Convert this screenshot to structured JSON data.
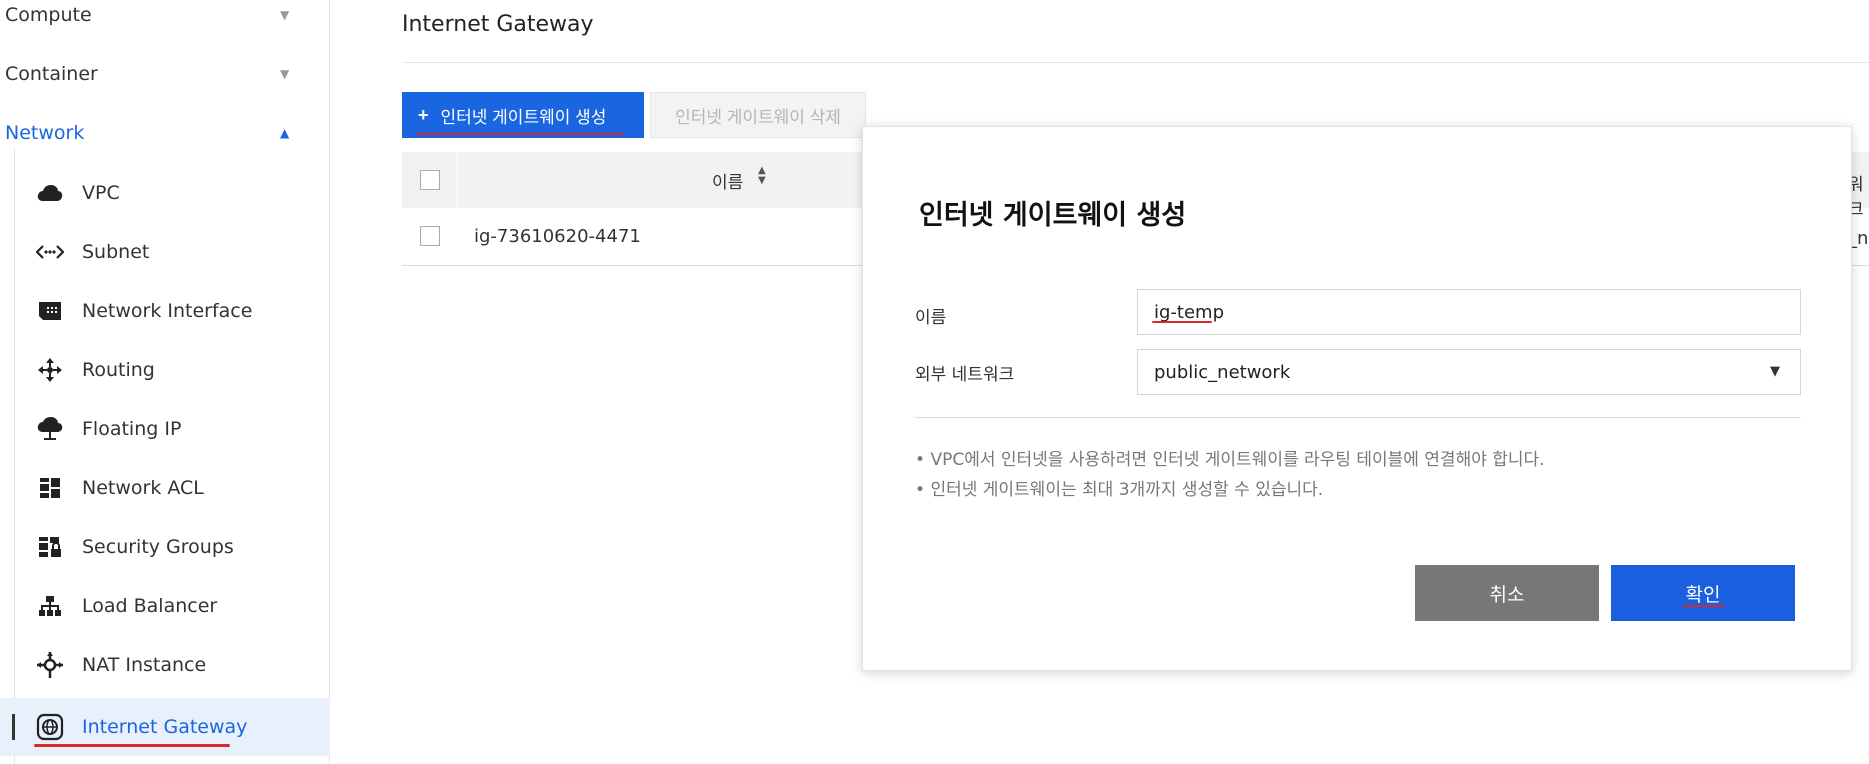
{
  "sidebar": {
    "categories": [
      {
        "label": "Compute",
        "expanded": false
      },
      {
        "label": "Container",
        "expanded": false
      },
      {
        "label": "Network",
        "expanded": true
      }
    ],
    "items": [
      {
        "label": "VPC",
        "icon": "cloud-icon"
      },
      {
        "label": "Subnet",
        "icon": "code-arrows-icon"
      },
      {
        "label": "Network Interface",
        "icon": "network-card-icon"
      },
      {
        "label": "Routing",
        "icon": "routing-arrows-icon"
      },
      {
        "label": "Floating IP",
        "icon": "cloud-pin-icon"
      },
      {
        "label": "Network ACL",
        "icon": "acl-grid-icon"
      },
      {
        "label": "Security Groups",
        "icon": "security-grid-lock-icon"
      },
      {
        "label": "Load Balancer",
        "icon": "hierarchy-icon"
      },
      {
        "label": "NAT Instance",
        "icon": "nat-node-icon"
      },
      {
        "label": "Internet Gateway",
        "icon": "gateway-globe-icon",
        "active": true
      }
    ]
  },
  "main": {
    "title": "Internet Gateway",
    "toolbar": {
      "create_label": "인터넷 게이트웨이 생성",
      "create_icon": "+",
      "delete_label": "인터넷 게이트웨이 삭제"
    },
    "table": {
      "columns": [
        "이름"
      ],
      "sort_icon": "▲▼",
      "rows": [
        {
          "name": "ig-73610620-4471"
        }
      ],
      "cut_header_text": "워크",
      "cut_cell_text": "_n"
    }
  },
  "modal": {
    "title": "인터넷 게이트웨이 생성",
    "name_label": "이름",
    "name_value": "ig-temp",
    "network_label": "외부 네트워크",
    "network_value": "public_network",
    "notes": [
      "VPC에서 인터넷을 사용하려면 인터넷 게이트웨이를 라우팅 테이블에 연결해야 합니다.",
      "인터넷 게이트웨이는 최대 3개까지 생성할 수 있습니다."
    ],
    "cancel_label": "취소",
    "ok_label": "확인"
  },
  "colors": {
    "accent": "#1a66e0",
    "annotation": "#d92a2a",
    "cancel": "#777777"
  }
}
